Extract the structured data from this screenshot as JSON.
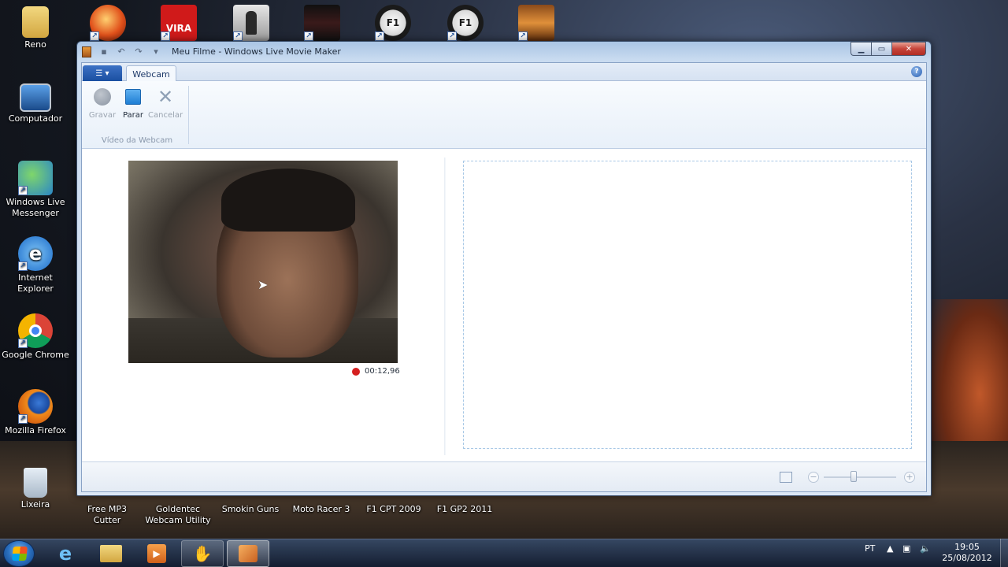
{
  "desktop": {
    "left_icons": [
      {
        "label": "Reno",
        "icon": "folder-icon"
      },
      {
        "label": "Computador",
        "icon": "computer-icon"
      },
      {
        "label": "Windows Live Messenger",
        "icon": "messenger-icon"
      },
      {
        "label": "Internet Explorer",
        "icon": "ie-icon"
      },
      {
        "label": "Google Chrome",
        "icon": "chrome-icon"
      },
      {
        "label": "Mozilla Firefox",
        "icon": "firefox-icon"
      },
      {
        "label": "Lixeira",
        "icon": "recycle-bin-icon"
      }
    ],
    "top_icons": [
      {
        "icon": "game-ball-icon",
        "text": ""
      },
      {
        "icon": "avira-icon",
        "text": "VIRA"
      },
      {
        "icon": "counter-strike-icon",
        "text": ""
      },
      {
        "icon": "game-dark-icon",
        "text": ""
      },
      {
        "icon": "ea-f1-icon",
        "text": "F1"
      },
      {
        "icon": "ea-f1-icon",
        "text": "F1"
      },
      {
        "icon": "smokin-guns-icon",
        "text": ""
      }
    ],
    "bottom_labels": [
      "Free MP3 Cutter",
      "Goldentec Webcam Utility",
      "Smokin Guns",
      "Moto Racer 3",
      "F1 CPT 2009",
      "F1 GP2 2011"
    ]
  },
  "window": {
    "title": "Meu Filme - Windows Live Movie Maker",
    "tab_label": "Webcam",
    "ribbon": {
      "record_label": "Gravar",
      "stop_label": "Parar",
      "cancel_label": "Cancelar",
      "group_label": "Vídeo da Webcam"
    },
    "timer": "00:12,96"
  },
  "taskbar": {
    "language": "PT",
    "time": "19:05",
    "date": "25/08/2012"
  },
  "colors": {
    "record_red": "#d52020",
    "stop_blue": "#1e7ed4",
    "ribbon_bg": "#e8f0f9"
  }
}
